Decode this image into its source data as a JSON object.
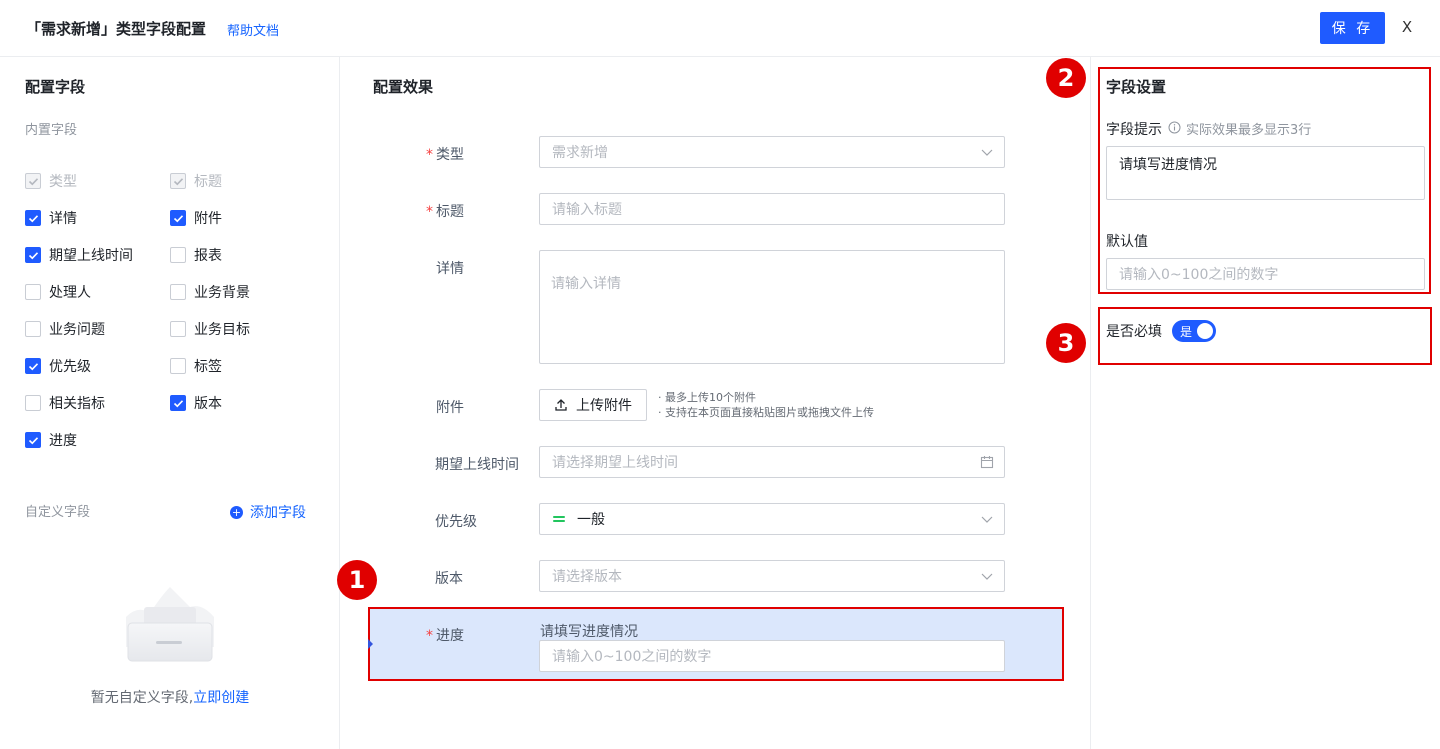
{
  "header": {
    "title": "「需求新增」类型字段配置",
    "help_link": "帮助文档",
    "save_label": "保 存",
    "close_label": "X"
  },
  "left": {
    "title": "配置字段",
    "builtin_label": "内置字段",
    "builtin_fields": [
      {
        "label": "类型",
        "checked": true,
        "disabled": true
      },
      {
        "label": "标题",
        "checked": true,
        "disabled": true
      },
      {
        "label": "详情",
        "checked": true,
        "disabled": false
      },
      {
        "label": "附件",
        "checked": true,
        "disabled": false
      },
      {
        "label": "期望上线时间",
        "checked": true,
        "disabled": false
      },
      {
        "label": "报表",
        "checked": false,
        "disabled": false
      },
      {
        "label": "处理人",
        "checked": false,
        "disabled": false
      },
      {
        "label": "业务背景",
        "checked": false,
        "disabled": false
      },
      {
        "label": "业务问题",
        "checked": false,
        "disabled": false
      },
      {
        "label": "业务目标",
        "checked": false,
        "disabled": false
      },
      {
        "label": "优先级",
        "checked": true,
        "disabled": false
      },
      {
        "label": "标签",
        "checked": false,
        "disabled": false
      },
      {
        "label": "相关指标",
        "checked": false,
        "disabled": false
      },
      {
        "label": "版本",
        "checked": true,
        "disabled": false
      },
      {
        "label": "进度",
        "checked": true,
        "disabled": false
      }
    ],
    "custom_label": "自定义字段",
    "add_field_label": "添加字段",
    "empty_text": "暂无自定义字段,",
    "empty_link": "立即创建"
  },
  "middle": {
    "title": "配置效果",
    "type_label": "类型",
    "type_value": "需求新增",
    "title_label": "标题",
    "title_placeholder": "请输入标题",
    "detail_label": "详情",
    "detail_placeholder": "请输入详情",
    "attachment_label": "附件",
    "upload_label": "上传附件",
    "upload_hint_1": "· 最多上传10个附件",
    "upload_hint_2": "· 支持在本页面直接粘贴图片或拖拽文件上传",
    "expected_label": "期望上线时间",
    "expected_placeholder": "请选择期望上线时间",
    "priority_label": "优先级",
    "priority_value": "一般",
    "version_label": "版本",
    "version_placeholder": "请选择版本",
    "progress_label": "进度",
    "progress_hint": "请填写进度情况",
    "progress_placeholder": "请输入0~100之间的数字"
  },
  "right": {
    "title": "字段设置",
    "hint_label": "字段提示",
    "hint_note": "实际效果最多显示3行",
    "hint_value": "请填写进度情况",
    "default_label": "默认值",
    "default_placeholder": "请输入0~100之间的数字",
    "required_label": "是否必填",
    "required_toggle_text": "是"
  },
  "badges": [
    "1",
    "2",
    "3"
  ],
  "colors": {
    "primary": "#1f5bff",
    "link": "#1664ff",
    "highlight": "#e00000",
    "required_star": "#f53f3f",
    "priority_green": "#22c55e"
  }
}
